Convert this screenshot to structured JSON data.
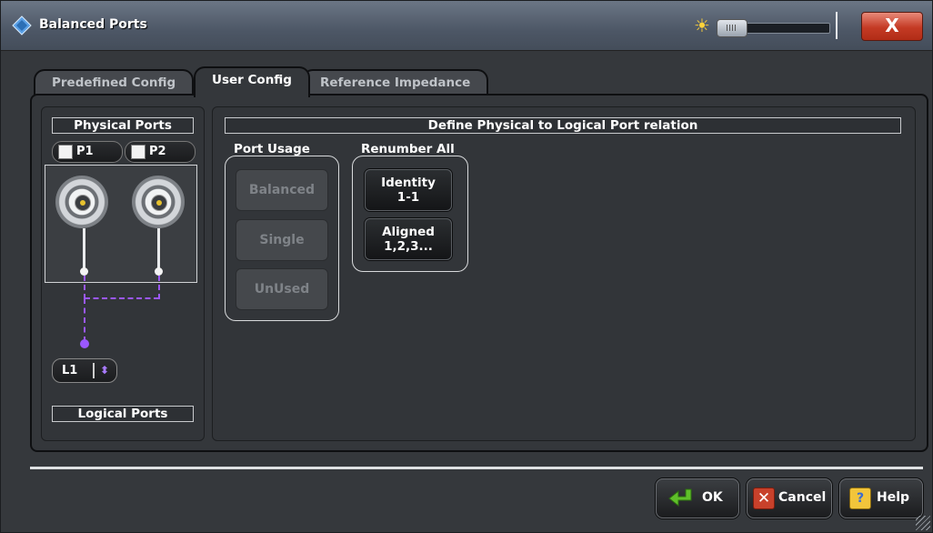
{
  "window": {
    "title": "Balanced Ports",
    "close_label": "X"
  },
  "tabs": [
    {
      "label": "Predefined Config",
      "active": false
    },
    {
      "label": "User Config",
      "active": true
    },
    {
      "label": "Reference Impedance",
      "active": false
    }
  ],
  "left_panel": {
    "physical_header": "Physical Ports",
    "ports": [
      {
        "label": "P1",
        "checked": false
      },
      {
        "label": "P2",
        "checked": false
      }
    ],
    "logical_port_value": "L1",
    "logical_header": "Logical Ports"
  },
  "right_panel": {
    "header": "Define Physical to Logical Port relation",
    "port_usage": {
      "label": "Port Usage",
      "buttons": [
        "Balanced",
        "Single",
        "UnUsed"
      ]
    },
    "renumber_all": {
      "label": "Renumber All",
      "identity": {
        "line1": "Identity",
        "line2": "1-1"
      },
      "aligned": {
        "line1": "Aligned",
        "line2": "1,2,3..."
      }
    }
  },
  "footer": {
    "ok_label": "OK",
    "cancel_label": "Cancel",
    "help_label": "Help"
  },
  "colors": {
    "logical_link": "#9b58ff",
    "connector_center": "#e6c12e",
    "close_button": "#c43a24"
  }
}
